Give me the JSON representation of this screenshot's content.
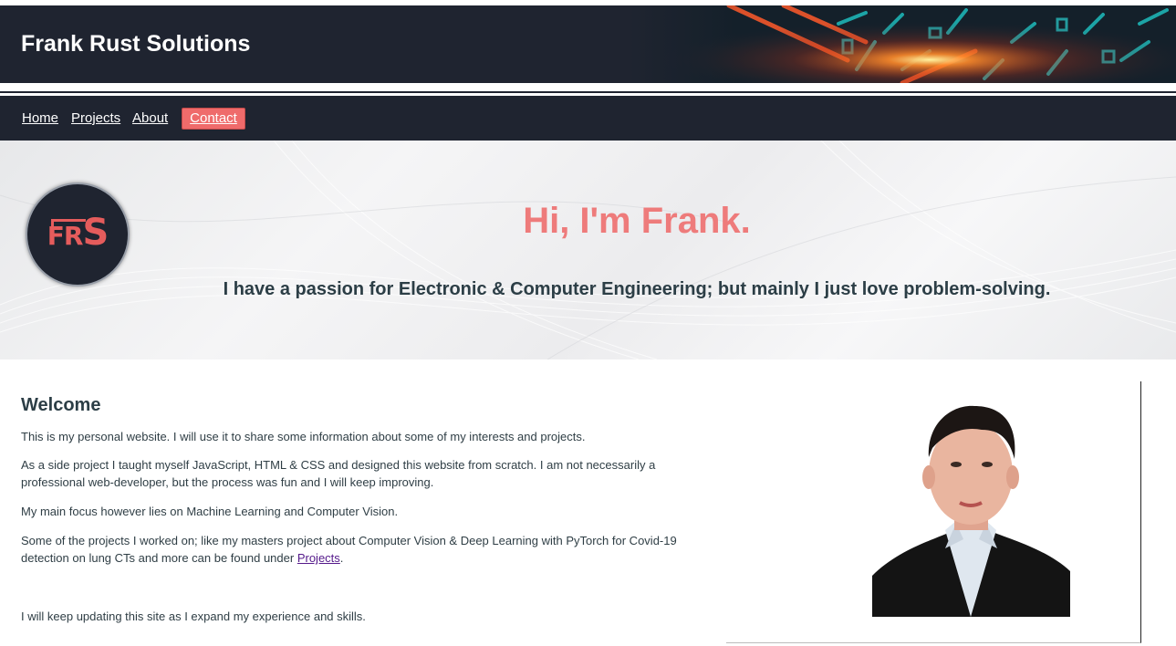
{
  "header": {
    "site_title": "Frank Rust Solutions"
  },
  "nav": {
    "items": [
      {
        "label": "Home"
      },
      {
        "label": "Projects"
      },
      {
        "label": "About"
      },
      {
        "label": "Contact"
      }
    ]
  },
  "hero": {
    "logo_letters": {
      "part1": "FR",
      "part2": "S"
    },
    "title": "Hi, I'm Frank.",
    "subtitle": "I have a passion for Electronic & Computer Engineering; but mainly I just love problem-solving."
  },
  "welcome": {
    "heading": "Welcome",
    "p1": "This is my personal website. I will use it to share some information about some of my interests and projects.",
    "p2": "As a side project I taught myself JavaScript, HTML & CSS and designed this website from scratch. I am not necessarily a professional web-developer, but the process was fun and I will keep improving.",
    "p3": "My main focus however lies on Machine Learning and Computer Vision.",
    "p4_before": "Some of the projects I worked on; like my masters project about Computer Vision & Deep Learning with PyTorch for Covid-19 detection on lung CTs and more can be found under ",
    "p4_link": "Projects",
    "p4_after": ".",
    "p5": "I will keep updating this site as I expand my experience and skills."
  },
  "colors": {
    "header_bg": "#1f2430",
    "accent": "#ef6b6b",
    "hero_title": "#ee7b7b",
    "text": "#2f3e45"
  }
}
